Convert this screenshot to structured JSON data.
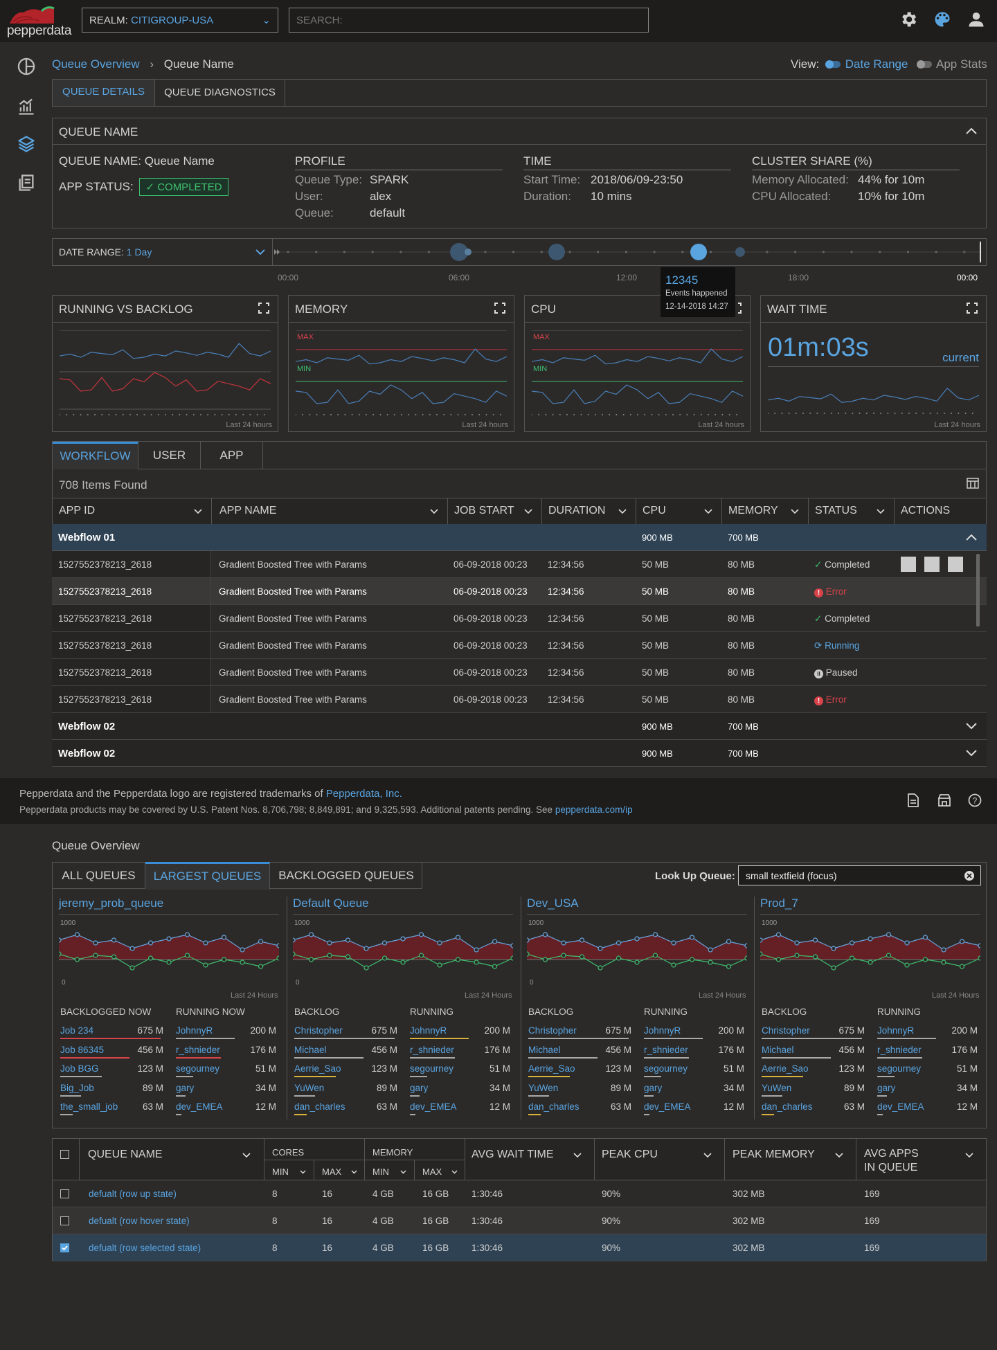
{
  "app": {
    "logo_text": "pepperdata"
  },
  "header": {
    "realm_label": "REALM:",
    "realm_value": "CITIGROUP-USA",
    "search_placeholder": "SEARCH:"
  },
  "breadcrumb": {
    "root": "Queue Overview",
    "current": "Queue Name"
  },
  "view": {
    "label": "View:",
    "date_range": "Date Range",
    "app_stats": "App Stats"
  },
  "tabs": {
    "details": "QUEUE DETAILS",
    "diagnostics": "QUEUE DIAGNOSTICS"
  },
  "queue_panel": {
    "title": "QUEUE NAME",
    "name_label": "QUEUE NAME:",
    "name_value": "Queue Name",
    "status_label": "APP STATUS:",
    "status_value": "COMPLETED",
    "profile": {
      "title": "PROFILE",
      "rows": [
        {
          "k": "Queue Type:",
          "v": "SPARK"
        },
        {
          "k": "User:",
          "v": "alex"
        },
        {
          "k": "Queue:",
          "v": "default"
        }
      ]
    },
    "time": {
      "title": "TIME",
      "rows": [
        {
          "k": "Start Time:",
          "v": "2018/06/09-23:50"
        },
        {
          "k": "Duration:",
          "v": "10 mins"
        }
      ]
    },
    "cluster": {
      "title": "CLUSTER SHARE (%)",
      "rows": [
        {
          "k": "Memory Allocated:",
          "v": "44% for 10m"
        },
        {
          "k": "CPU Allocated:",
          "v": "10% for 10m"
        }
      ]
    }
  },
  "date_range": {
    "label": "DATE RANGE:",
    "value": "1 Day",
    "ticks": [
      "00:00",
      "06:00",
      "12:00",
      "18:00",
      "00:00"
    ],
    "tooltip": {
      "value": "12345",
      "text": "Events happened",
      "date": "12-14-2018 14:27"
    }
  },
  "charts": {
    "running": {
      "title": "RUNNING VS BACKLOG",
      "foot": "Last 24 hours"
    },
    "memory": {
      "title": "MEMORY",
      "max": "MAX",
      "min": "MIN",
      "foot": "Last 24 hours"
    },
    "cpu": {
      "title": "CPU",
      "max": "MAX",
      "min": "MIN",
      "foot": "Last 24 hours"
    },
    "wait": {
      "title": "WAIT TIME",
      "value": "01m:03s",
      "current": "current",
      "foot": "Last 24 hours"
    }
  },
  "workflow": {
    "tabs": [
      "WORKFLOW",
      "USER",
      "APP"
    ],
    "count": "708 Items Found",
    "columns": [
      "APP ID",
      "APP NAME",
      "JOB START",
      "DURATION",
      "CPU",
      "MEMORY",
      "STATUS",
      "ACTIONS"
    ],
    "group1": {
      "name": "Webflow 01",
      "cpu": "900 MB",
      "mem": "700 MB"
    },
    "rows": [
      {
        "id": "1527552378213_2618",
        "name": "Gradient Boosted Tree with Params",
        "start": "06-09-2018 00:23",
        "dur": "12:34:56",
        "cpu": "50 MB",
        "mem": "80 MB",
        "status": "Completed"
      },
      {
        "id": "1527552378213_2618",
        "name": "Gradient Boosted Tree with Params",
        "start": "06-09-2018 00:23",
        "dur": "12:34:56",
        "cpu": "50 MB",
        "mem": "80 MB",
        "status": "Error"
      },
      {
        "id": "1527552378213_2618",
        "name": "Gradient Boosted Tree with Params",
        "start": "06-09-2018 00:23",
        "dur": "12:34:56",
        "cpu": "50 MB",
        "mem": "80 MB",
        "status": "Completed"
      },
      {
        "id": "1527552378213_2618",
        "name": "Gradient Boosted Tree with Params",
        "start": "06-09-2018 00:23",
        "dur": "12:34:56",
        "cpu": "50 MB",
        "mem": "80 MB",
        "status": "Running"
      },
      {
        "id": "1527552378213_2618",
        "name": "Gradient Boosted Tree with Params",
        "start": "06-09-2018 00:23",
        "dur": "12:34:56",
        "cpu": "50 MB",
        "mem": "80 MB",
        "status": "Paused"
      },
      {
        "id": "1527552378213_2618",
        "name": "Gradient Boosted Tree with Params",
        "start": "06-09-2018 00:23",
        "dur": "12:34:56",
        "cpu": "50 MB",
        "mem": "80 MB",
        "status": "Error"
      }
    ],
    "group2": {
      "name": "Webflow 02",
      "cpu": "900 MB",
      "mem": "700 MB"
    },
    "group3": {
      "name": "Webflow 02",
      "cpu": "900 MB",
      "mem": "700 MB"
    }
  },
  "footer": {
    "line1_pre": "Pepperdata and the Pepperdata logo are registered trademarks of ",
    "line1_link": "Pepperdata, Inc.",
    "line2_pre": "Pepperdata products may be covered by U.S. Patent Nos. 8,706,798; 8,849,891; and 9,325,593. Additional patents pending. See ",
    "line2_link": "pepperdata.com/ip"
  },
  "overview": {
    "title": "Queue Overview",
    "tabs": [
      "ALL QUEUES",
      "LARGEST QUEUES",
      "BACKLOGGED QUEUES"
    ],
    "lookup_label": "Look Up Queue:",
    "lookup_value": "small textfield (focus)",
    "queues": [
      {
        "name": "jeremy_prob_queue",
        "axis_top": "1000",
        "axis_bottom": "0",
        "foot": "Last 24 Hours",
        "left_h": "BACKLOGGED NOW",
        "right_h": "RUNNING NOW",
        "left": [
          {
            "n": "Job 234",
            "v": "675 M"
          },
          {
            "n": "Job 86345",
            "v": "456 M"
          },
          {
            "n": "Job BGG",
            "v": "123 M"
          },
          {
            "n": "Big_Job",
            "v": "89 M"
          },
          {
            "n": "the_small_job",
            "v": "63 M"
          }
        ],
        "right": [
          {
            "n": "JohnnyR",
            "v": "200 M"
          },
          {
            "n": "r_shnieder",
            "v": "176 M"
          },
          {
            "n": "segourney",
            "v": "51 M"
          },
          {
            "n": "gary",
            "v": "34 M"
          },
          {
            "n": "dev_EMEA",
            "v": "12 M"
          }
        ]
      },
      {
        "name": "Default Queue",
        "axis_top": "1000",
        "axis_bottom": "0",
        "foot": "Last 24 Hours",
        "left_h": "BACKLOG",
        "right_h": "RUNNING",
        "left": [
          {
            "n": "Christopher",
            "v": "675 M"
          },
          {
            "n": "Michael",
            "v": "456 M"
          },
          {
            "n": "Aerrie_Sao",
            "v": "123 M"
          },
          {
            "n": "YuWen",
            "v": "89 M"
          },
          {
            "n": "dan_charles",
            "v": "63 M"
          }
        ],
        "right": [
          {
            "n": "JohnnyR",
            "v": "200 M"
          },
          {
            "n": "r_shnieder",
            "v": "176 M"
          },
          {
            "n": "segourney",
            "v": "51 M"
          },
          {
            "n": "gary",
            "v": "34 M"
          },
          {
            "n": "dev_EMEA",
            "v": "12 M"
          }
        ]
      },
      {
        "name": "Dev_USA",
        "axis_top": "1000",
        "axis_bottom": "0",
        "foot": "Last 24 Hours",
        "left_h": "BACKLOG",
        "right_h": "RUNNING",
        "left": [
          {
            "n": "Christopher",
            "v": "675 M"
          },
          {
            "n": "Michael",
            "v": "456 M"
          },
          {
            "n": "Aerrie_Sao",
            "v": "123 M"
          },
          {
            "n": "YuWen",
            "v": "89 M"
          },
          {
            "n": "dan_charles",
            "v": "63 M"
          }
        ],
        "right": [
          {
            "n": "JohnnyR",
            "v": "200 M"
          },
          {
            "n": "r_shnieder",
            "v": "176 M"
          },
          {
            "n": "segourney",
            "v": "51 M"
          },
          {
            "n": "gary",
            "v": "34 M"
          },
          {
            "n": "dev_EMEA",
            "v": "12 M"
          }
        ]
      },
      {
        "name": "Prod_7",
        "axis_top": "1000",
        "axis_bottom": "",
        "foot": "Last 24 Hours",
        "left_h": "BACKLOG",
        "right_h": "RUNNING",
        "left": [
          {
            "n": "Christopher",
            "v": "675 M"
          },
          {
            "n": "Michael",
            "v": "456 M"
          },
          {
            "n": "Aerrie_Sao",
            "v": "123 M"
          },
          {
            "n": "YuWen",
            "v": "89 M"
          },
          {
            "n": "dan_charles",
            "v": "63 M"
          }
        ],
        "right": [
          {
            "n": "JohnnyR",
            "v": "200 M"
          },
          {
            "n": "r_shnieder",
            "v": "176 M"
          },
          {
            "n": "segourney",
            "v": "51 M"
          },
          {
            "n": "gary",
            "v": "34 M"
          },
          {
            "n": "dev_EMEA",
            "v": "12 M"
          }
        ]
      }
    ]
  },
  "queue_table": {
    "columns": {
      "name": "QUEUE NAME",
      "cores": "CORES",
      "memory": "MEMORY",
      "min": "MIN",
      "max": "MAX",
      "avg_wait": "AVG WAIT TIME",
      "peak_cpu": "PEAK CPU",
      "peak_mem": "PEAK MEMORY",
      "avg_apps_1": "AVG APPS",
      "avg_apps_2": "IN QUEUE"
    },
    "rows": [
      {
        "name": "defualt (row up state)",
        "cmin": "8",
        "cmax": "16",
        "mmin": "4 GB",
        "mmax": "16 GB",
        "wait": "1:30:46",
        "cpu": "90%",
        "mem": "302 MB",
        "apps": "169"
      },
      {
        "name": "defualt (row hover state)",
        "cmin": "8",
        "cmax": "16",
        "mmin": "4 GB",
        "mmax": "16 GB",
        "wait": "1:30:46",
        "cpu": "90%",
        "mem": "302 MB",
        "apps": "169"
      },
      {
        "name": "defualt (row selected state)",
        "cmin": "8",
        "cmax": "16",
        "mmin": "4 GB",
        "mmax": "16 GB",
        "wait": "1:30:46",
        "cpu": "90%",
        "mem": "302 MB",
        "apps": "169"
      }
    ]
  },
  "colors": {
    "accent": "#5aa4e0",
    "success": "#3fbf6e",
    "error": "#d9434a",
    "warning": "#d8b23a",
    "background": "#2b2a29",
    "header": "#1e1d1c"
  }
}
